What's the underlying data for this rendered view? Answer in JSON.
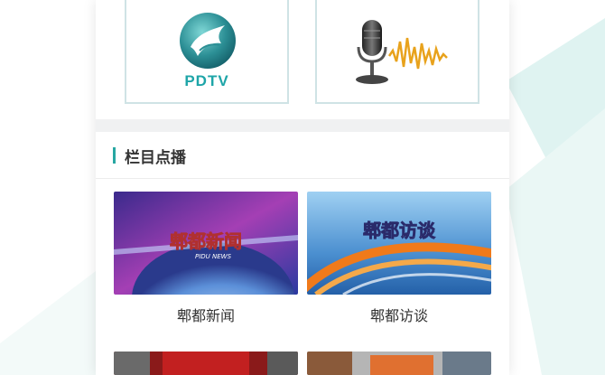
{
  "live": {
    "tv_channel_logo_text": "PDTV"
  },
  "program_section": {
    "title": "栏目点播",
    "items": [
      {
        "label": "郫都新闻",
        "thumb_title": "郫都新闻",
        "thumb_subtitle": "PIDU NEWS"
      },
      {
        "label": "郫都访谈",
        "thumb_title": "郫都访谈"
      },
      {
        "label": ""
      },
      {
        "label": ""
      }
    ]
  },
  "colors": {
    "accent": "#27a7a2",
    "card_border": "#cfe3e5",
    "page_bg": "#f0f1f2"
  },
  "icons": [
    "pdtv-logo-icon",
    "microphone-icon"
  ]
}
